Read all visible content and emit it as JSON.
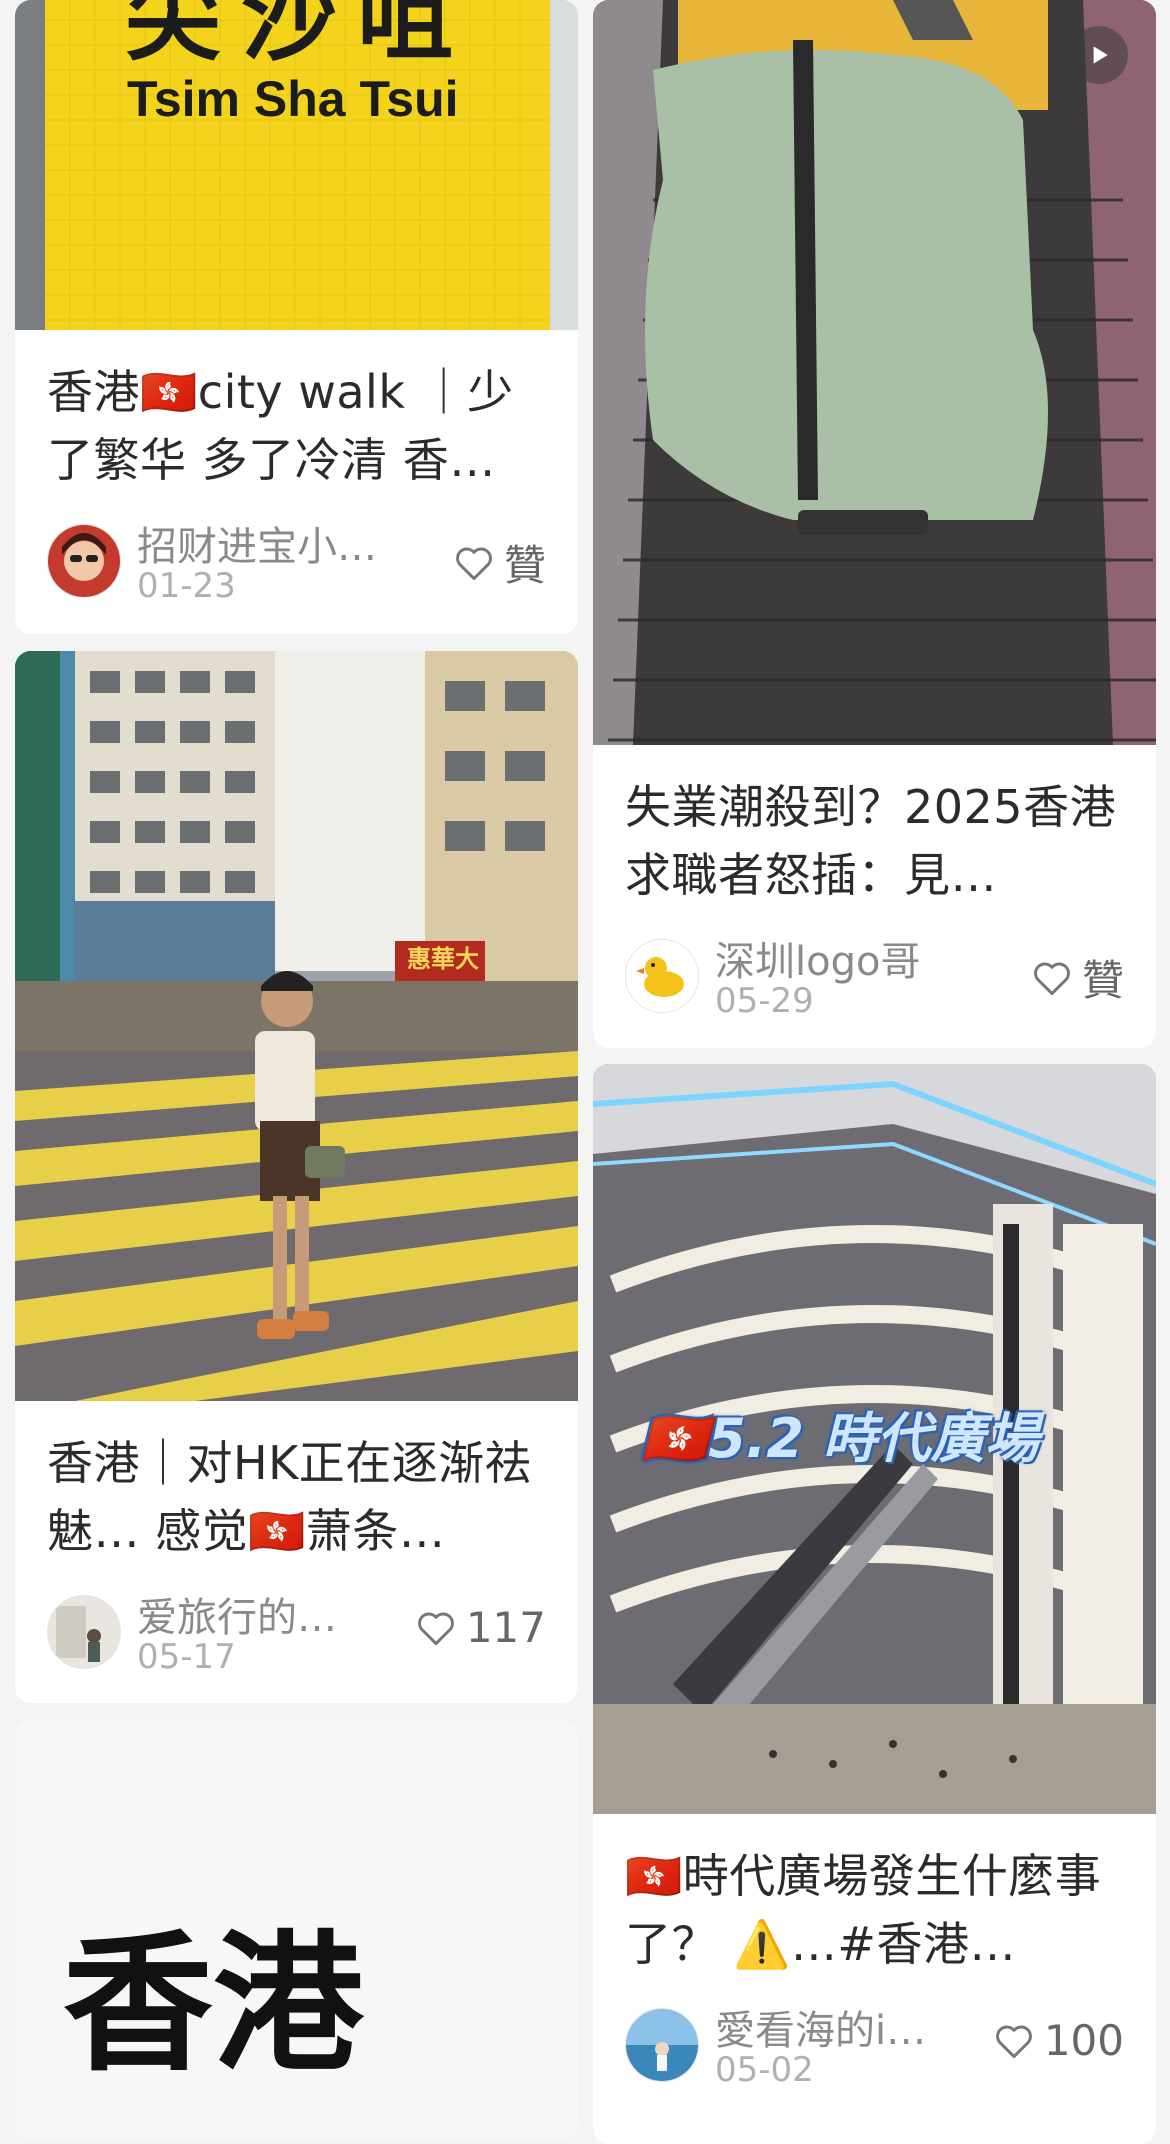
{
  "cards": [
    {
      "thumb_sign_text": "Tsim Sha Tsui",
      "thumb_sign_chinese": "尖沙咀",
      "title": "香港🇭🇰city walk ｜少了繁华 多了冷清 香…",
      "author": "招财进宝小…",
      "date": "01-23",
      "likes": "贊"
    },
    {
      "title": "失業潮殺到？2025香港求職者怒插：見…",
      "author": "深圳logo哥",
      "date": "05-29",
      "likes": "贊"
    },
    {
      "thumb_signboard": "惠華大",
      "title": "香港｜对HK正在逐渐祛魅… 感觉🇭🇰萧条…",
      "author": "爱旅行的…",
      "date": "05-17",
      "likes": "117"
    },
    {
      "thumb_overlay": "🇭🇰5.2 時代廣場",
      "title": "🇭🇰時代廣場發生什麼事了？ ⚠️…#香港…",
      "author": "愛看海的i…",
      "date": "05-02",
      "likes": "100"
    }
  ],
  "partial_card": {
    "big_title": "香港"
  },
  "colors": {
    "background": "#f4f4f4",
    "card": "#ffffff",
    "mtr_yellow": "#f3d31b",
    "hk_red": "#d42b2b"
  },
  "icons": [
    "play-icon",
    "heart-icon",
    "hk-flag-icon",
    "duck-logo-icon",
    "warning-icon"
  ]
}
